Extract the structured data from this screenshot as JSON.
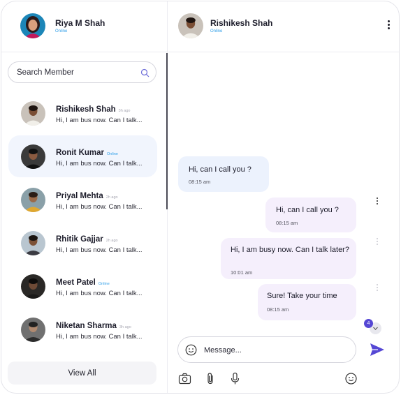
{
  "current_user": {
    "name": "Riya M Shah",
    "status": "Online"
  },
  "search": {
    "placeholder": "Search Member"
  },
  "contacts": [
    {
      "name": "Rishikesh Shah",
      "meta": "3h ago",
      "message": "Hi, I am bus now. Can I talk...",
      "online": false,
      "active": false
    },
    {
      "name": "Ronit Kumar",
      "meta": "Online",
      "message": "Hi, I am bus now. Can I talk...",
      "online": true,
      "active": true
    },
    {
      "name": "Priyal Mehta",
      "meta": "2h ago",
      "message": "Hi, I am bus now. Can I talk...",
      "online": false,
      "active": false
    },
    {
      "name": "Rhitik Gajjar",
      "meta": "2h ago",
      "message": "Hi, I am bus now. Can I talk...",
      "online": false,
      "active": false
    },
    {
      "name": "Meet Patel",
      "meta": "Online",
      "message": "Hi, I am bus now. Can I talk...",
      "online": true,
      "active": false
    },
    {
      "name": "Niketan Sharma",
      "meta": "3h ago",
      "message": "Hi, I am bus now. Can I talk...",
      "online": false,
      "active": false
    }
  ],
  "view_all_label": "View All",
  "chat": {
    "name": "Rishikesh Shah",
    "status": "Online",
    "messages": [
      {
        "direction": "incoming",
        "text": "Hi, can I call you ?",
        "time": "08:15 am"
      },
      {
        "direction": "outgoing",
        "text": "Hi, can I call you ?",
        "time": "08:15 am"
      },
      {
        "direction": "outgoing",
        "text": "Hi, I am busy now. Can I talk later?",
        "time": "10:01 am"
      },
      {
        "direction": "outgoing",
        "text": "Sure! Take your time",
        "time": "08:15 am"
      }
    ],
    "new_message_count": "4"
  },
  "composer": {
    "placeholder": "Message..."
  },
  "icons": [
    "search-icon",
    "more-vertical-icon",
    "chevron-down-icon",
    "emoji-icon",
    "send-icon",
    "camera-icon",
    "paperclip-icon",
    "microphone-icon"
  ],
  "colors": {
    "accent": "#5547d4",
    "online": "#2f9ee8",
    "incoming_bubble": "#ecf2fd",
    "outgoing_bubble": "#f5effc",
    "active_row": "#f1f5fd"
  }
}
